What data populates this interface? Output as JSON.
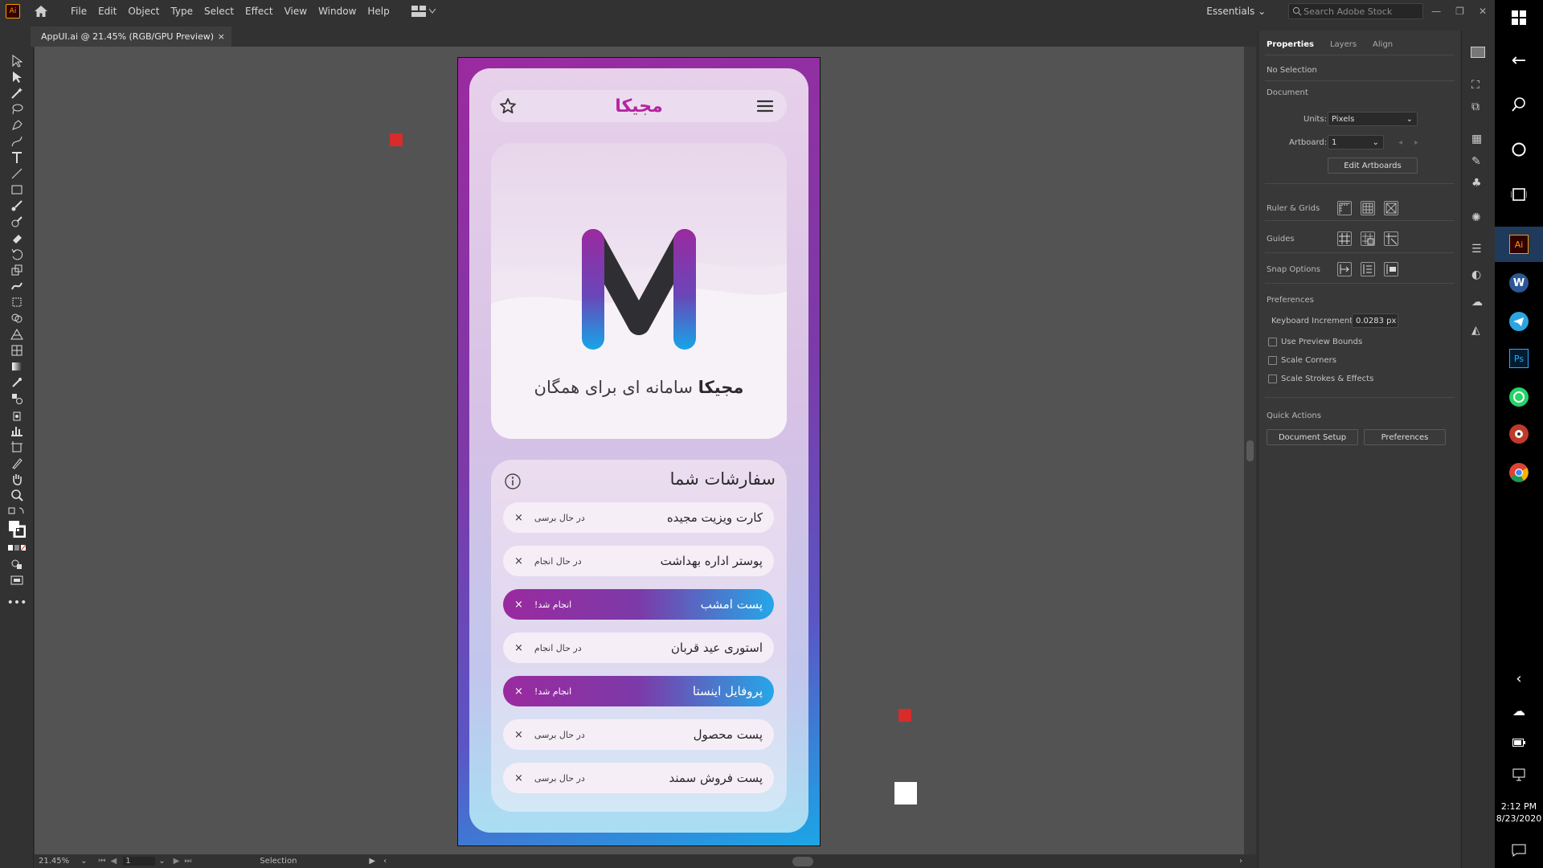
{
  "app": {
    "logo": "Ai",
    "menus": [
      "File",
      "Edit",
      "Object",
      "Type",
      "Select",
      "Effect",
      "View",
      "Window",
      "Help"
    ],
    "workspace": "Essentials",
    "search_placeholder": "Search Adobe Stock"
  },
  "document_tab": {
    "title": "AppUI.ai @ 21.45% (RGB/GPU Preview)",
    "close": "×"
  },
  "status_bar": {
    "zoom": "21.45%",
    "artboard": "1",
    "tool": "Selection"
  },
  "panel": {
    "tabs": [
      "Properties",
      "Layers",
      "Align"
    ],
    "selection": "No Selection",
    "document_heading": "Document",
    "units_label": "Units:",
    "units_value": "Pixels",
    "artboard_label": "Artboard:",
    "artboard_value": "1",
    "edit_artboards": "Edit Artboards",
    "ruler_grids": "Ruler & Grids",
    "guides": "Guides",
    "snap_options": "Snap Options",
    "preferences_heading": "Preferences",
    "keyboard_increment_label": "Keyboard Increment:",
    "keyboard_increment_value": "0.0283 px",
    "checkboxes": [
      "Use Preview Bounds",
      "Scale Corners",
      "Scale Strokes & Effects"
    ],
    "quick_actions": "Quick Actions",
    "document_setup": "Document Setup",
    "preferences_button": "Preferences"
  },
  "artwork": {
    "brand": "مجیکا",
    "hero_brand": "مجیکا",
    "hero_tagline": "سامانه ای برای همگان",
    "hero_letter": "M",
    "orders_title": "سفارشات شما",
    "orders": [
      {
        "name": "کارت ویزیت مجیده",
        "status": "در حال برسی",
        "done": false
      },
      {
        "name": "پوستر اداره بهداشت",
        "status": "در حال انجام",
        "done": false
      },
      {
        "name": "پست امشب",
        "status": "انجام شد!",
        "done": true
      },
      {
        "name": "استوری عید قربان",
        "status": "در حال انجام",
        "done": false
      },
      {
        "name": "پروفایل اینستا",
        "status": "انجام شد!",
        "done": true
      },
      {
        "name": "پست محصول",
        "status": "در حال برسی",
        "done": false
      },
      {
        "name": "پست فروش سمند",
        "status": "در حال برسی",
        "done": false
      }
    ],
    "remove_glyph": "×"
  },
  "taskbar": {
    "time": "2:12 PM",
    "date": "8/23/2020",
    "apps": [
      "Ai",
      "Ps"
    ]
  },
  "colors": {
    "artboard_purple": "#9b2a9f",
    "artboard_blue": "#1ba6e6",
    "brand_magenta": "#b5249f",
    "marker_red": "#d82b2b"
  }
}
